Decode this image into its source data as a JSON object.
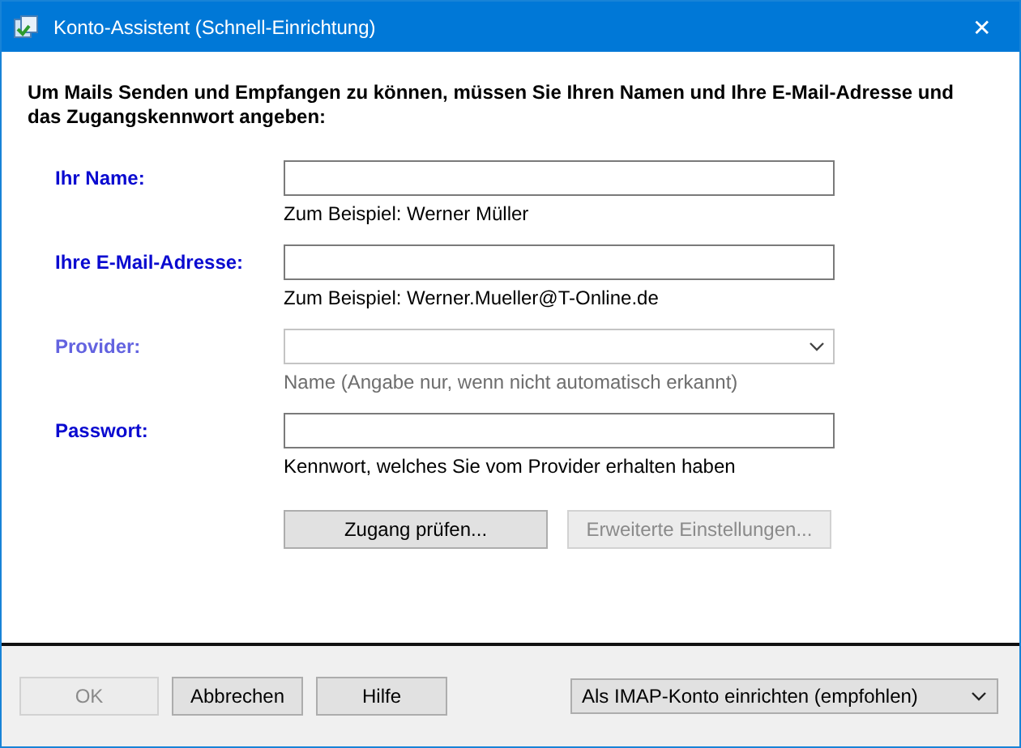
{
  "window": {
    "title": "Konto-Assistent (Schnell-Einrichtung)",
    "close": "✕"
  },
  "intro": "Um Mails Senden und Empfangen zu können,  müssen Sie Ihren Namen und Ihre E-Mail-Adresse und das Zugangskennwort angeben:",
  "fields": [
    {
      "label": "Ihr Name:",
      "kind": "text",
      "disabled": false,
      "hint": "Zum Beispiel: Werner Müller"
    },
    {
      "label": "Ihre E-Mail-Adresse:",
      "kind": "text",
      "disabled": false,
      "hint": "Zum Beispiel: Werner.Mueller@T-Online.de"
    },
    {
      "label": "Provider:",
      "kind": "dropdown",
      "disabled": true,
      "hint": "Name (Angabe nur, wenn nicht automatisch erkannt)"
    },
    {
      "label": "Passwort:",
      "kind": "text",
      "disabled": false,
      "hint": "Kennwort, welches Sie vom Provider erhalten haben"
    }
  ],
  "actions": [
    {
      "label": "Zugang prüfen...",
      "disabled": false
    },
    {
      "label": "Erweiterte Einstellungen...",
      "disabled": true
    }
  ],
  "footer_buttons": [
    {
      "label": "OK",
      "disabled": true
    },
    {
      "label": "Abbrechen",
      "disabled": false
    },
    {
      "label": "Hilfe",
      "disabled": false
    }
  ],
  "account_type": {
    "value": "Als IMAP-Konto einrichten (empfohlen)"
  }
}
